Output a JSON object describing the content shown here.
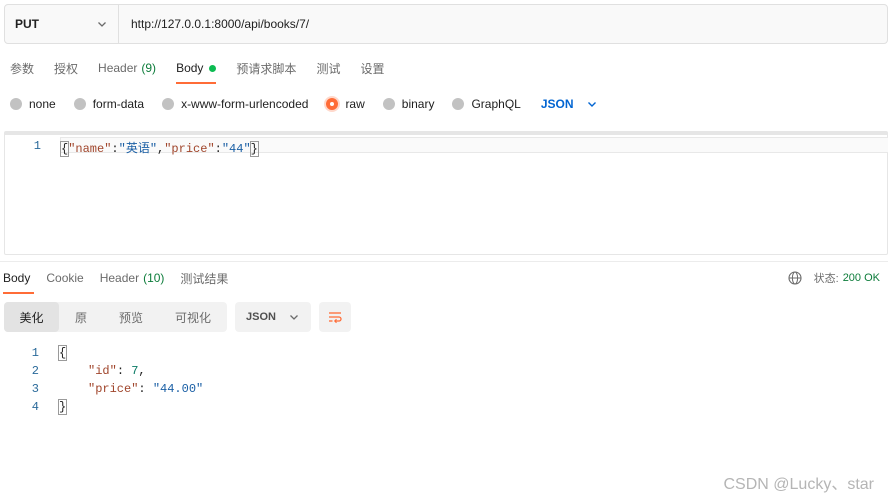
{
  "request": {
    "method": "PUT",
    "url": "http://127.0.0.1:8000/api/books/7/"
  },
  "request_tabs": [
    {
      "label": "参数"
    },
    {
      "label": "授权"
    },
    {
      "label": "Header",
      "count": "(9)"
    },
    {
      "label": "Body"
    },
    {
      "label": "预请求脚本"
    },
    {
      "label": "测试"
    },
    {
      "label": "设置"
    }
  ],
  "body_types": [
    {
      "label": "none",
      "selected": false
    },
    {
      "label": "form-data",
      "selected": false
    },
    {
      "label": "x-www-form-urlencoded",
      "selected": false
    },
    {
      "label": "raw",
      "selected": true
    },
    {
      "label": "binary",
      "selected": false
    },
    {
      "label": "GraphQL",
      "selected": false
    }
  ],
  "raw_format": "JSON",
  "request_body": {
    "line_number": "1",
    "code": "{\"name\":\"英语\",\"price\":\"44\"}",
    "open_brace": "{",
    "key1": "\"name\"",
    "colon": ":",
    "val1": "\"英语\"",
    "comma": ",",
    "key2": "\"price\"",
    "val2": "\"44\"",
    "close_brace": "}"
  },
  "response_tabs": [
    {
      "label": "Body"
    },
    {
      "label": "Cookie"
    },
    {
      "label": "Header",
      "count": "(10)"
    },
    {
      "label": "测试结果"
    }
  ],
  "status": {
    "label": "状态:",
    "value": "200 OK"
  },
  "view_modes": [
    "美化",
    "原",
    "预览",
    "可视化"
  ],
  "response_format": "JSON",
  "response_body": {
    "line_numbers": [
      "1",
      "2",
      "3",
      "4"
    ],
    "open_brace": "{",
    "id_key": "\"id\"",
    "id_val": "7",
    "price_key": "\"price\"",
    "price_val": "\"44.00\"",
    "close_brace": "}"
  },
  "watermark": "CSDN @Lucky、star",
  "colors": {
    "accent": "#ff6c37",
    "success": "#0cbb52",
    "link": "#0265d2"
  }
}
